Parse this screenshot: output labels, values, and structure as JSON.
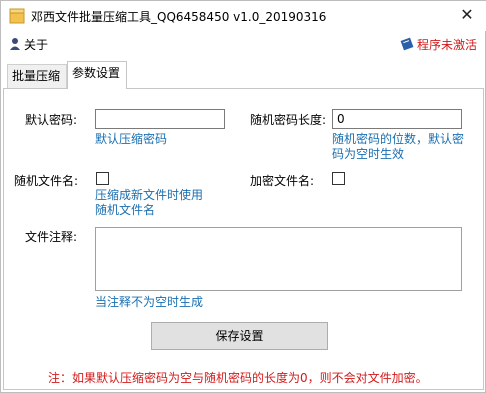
{
  "window": {
    "title": "邓西文件批量压缩工具_QQ6458450 v1.0_20190316",
    "close_glyph": "✕"
  },
  "menu": {
    "about_label": "关于",
    "activate_label": "程序未激活"
  },
  "tabs": [
    {
      "label": "批量压缩",
      "active": false
    },
    {
      "label": "参数设置",
      "active": true
    }
  ],
  "form": {
    "default_password": {
      "label": "默认密码:",
      "value": "",
      "hint": "默认压缩密码"
    },
    "random_password_length": {
      "label": "随机密码长度:",
      "value": "0",
      "hint_line1": "随机密码的位数，默认密",
      "hint_line2": "码为空时生效"
    },
    "random_filename": {
      "label": "随机文件名:",
      "checked": false,
      "hint_line1": "压缩成新文件时使用",
      "hint_line2": "随机文件名"
    },
    "encrypt_filename": {
      "label": "加密文件名:",
      "checked": false
    },
    "file_comment": {
      "label": "文件注释:",
      "value": "",
      "hint": "当注释不为空时生成"
    },
    "save_button": "保存设置"
  },
  "note": "注：如果默认压缩密码为空与随机密码的长度为0，则不会对文件加密。",
  "colors": {
    "accent_red": "#d21a1a",
    "hint_blue": "#1a6fb0"
  }
}
